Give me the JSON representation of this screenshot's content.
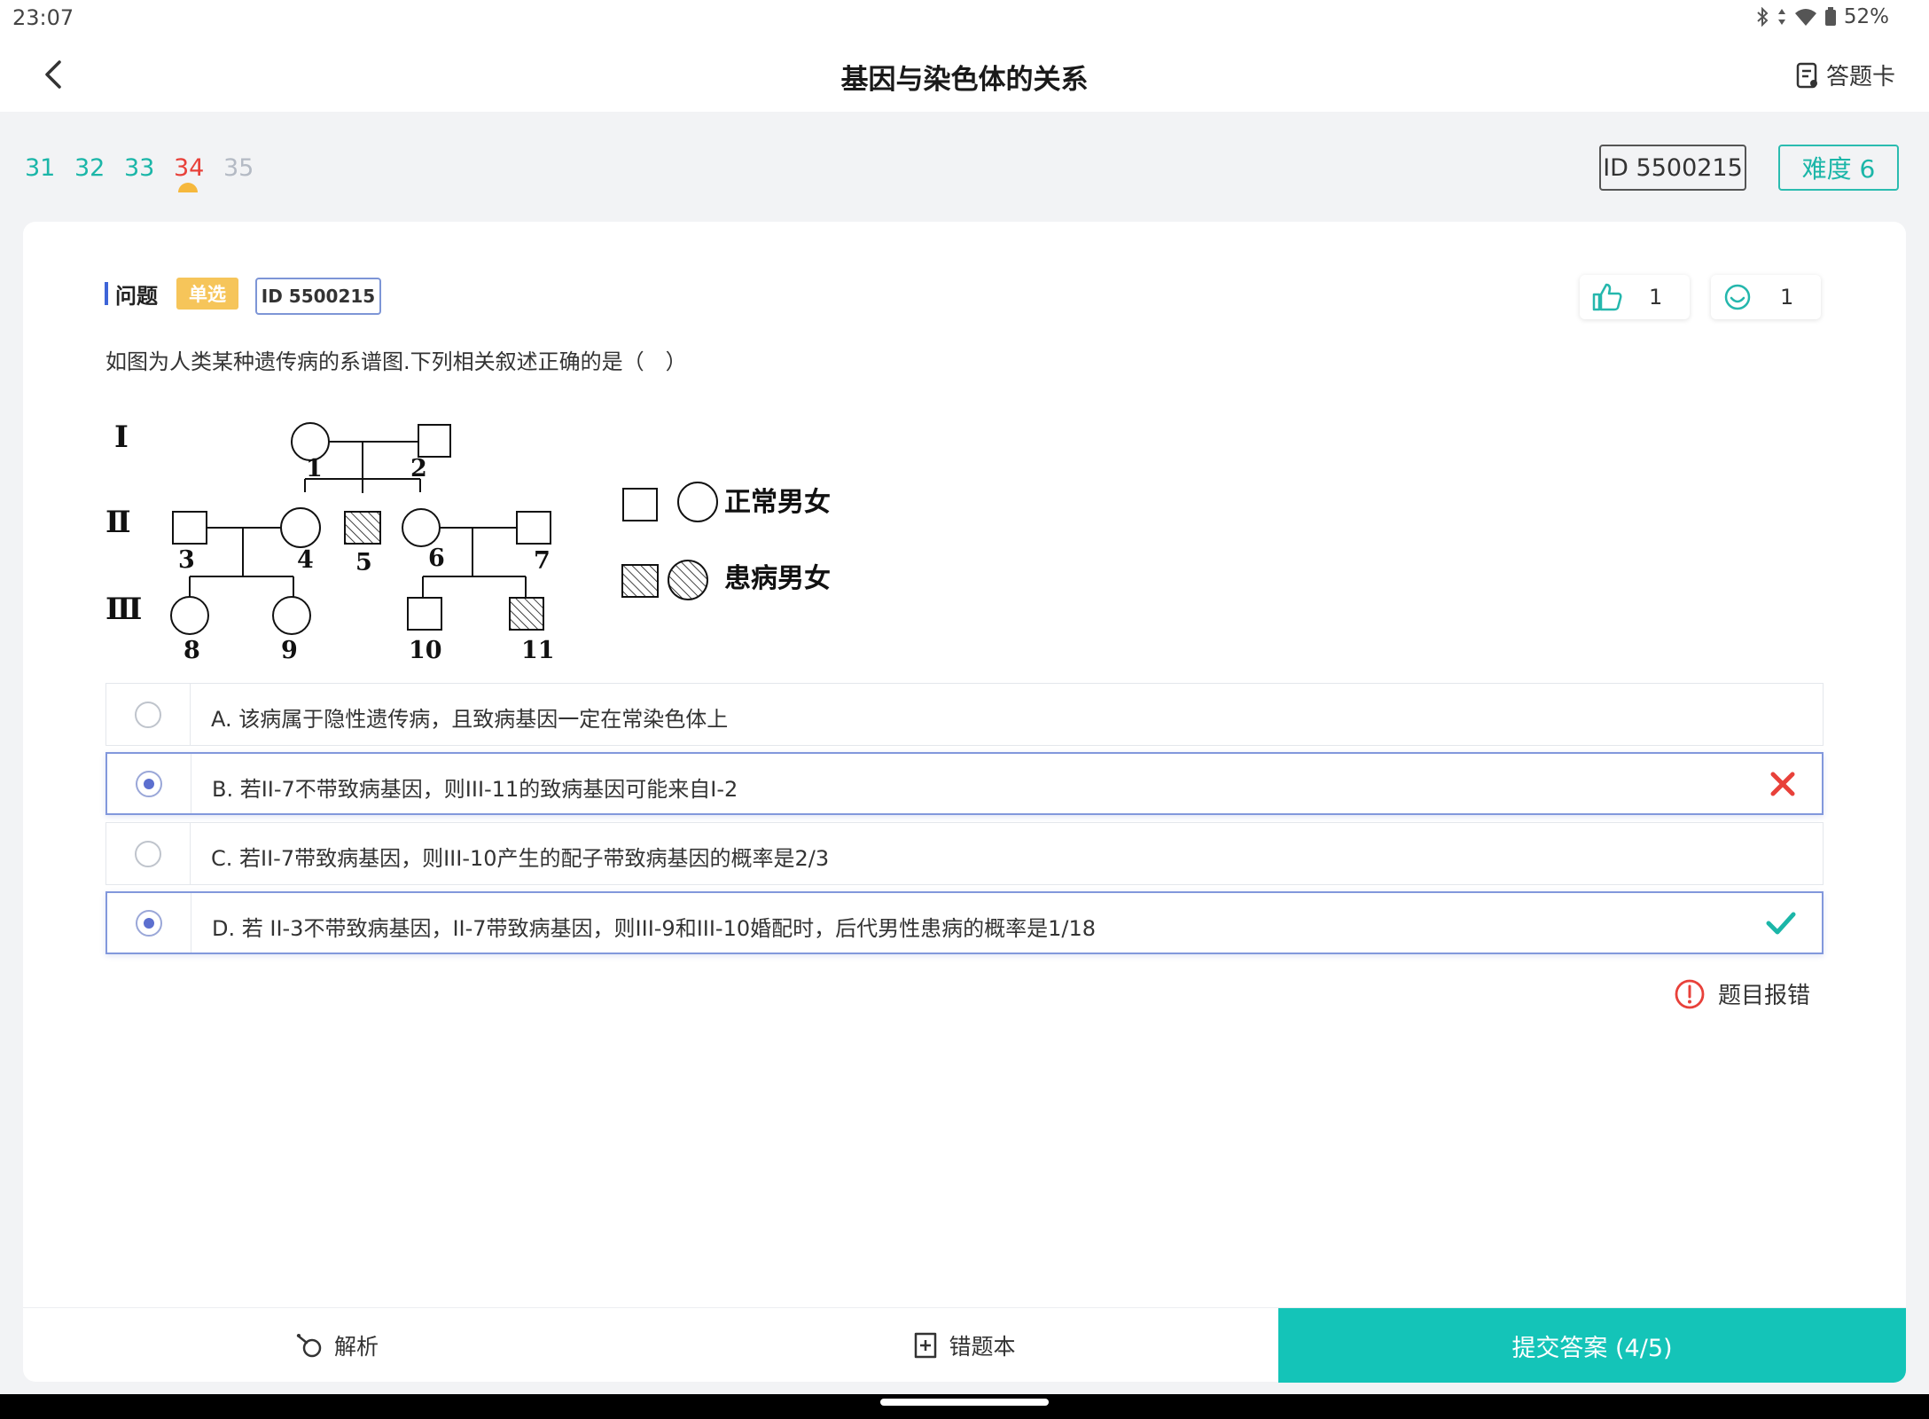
{
  "status_bar": {
    "time": "23:07",
    "battery": "52%"
  },
  "header": {
    "title": "基因与染色体的关系",
    "answer_card_label": "答题卡"
  },
  "question_nav": {
    "numbers": [
      "31",
      "32",
      "33",
      "34",
      "35"
    ],
    "id_label": "ID 5500215",
    "difficulty_label": "难度 6"
  },
  "question": {
    "label": "问题",
    "type": "单选",
    "id_label": "ID 5500215",
    "likes": "1",
    "smiles": "1",
    "stem": "如图为人类某种遗传病的系谱图.下列相关叙述正确的是（　）"
  },
  "pedigree": {
    "generations": [
      "Ⅰ",
      "Ⅱ",
      "Ⅲ"
    ],
    "individuals": [
      "1",
      "2",
      "3",
      "4",
      "5",
      "6",
      "7",
      "8",
      "9",
      "10",
      "11"
    ],
    "legend_normal": "正常男女",
    "legend_affected": "患病男女"
  },
  "options": [
    {
      "text": "A. 该病属于隐性遗传病，且致病基因一定在常染色体上",
      "selected": false,
      "result": ""
    },
    {
      "text": "B. 若II-7不带致病基因，则III-11的致病基因可能来自I-2",
      "selected": true,
      "result": "wrong"
    },
    {
      "text": "C. 若II-7带致病基因，则III-10产生的配子带致病基因的概率是2/3",
      "selected": false,
      "result": ""
    },
    {
      "text": "D. 若 II-3不带致病基因，II-7带致病基因，则III-9和III-10婚配时，后代男性患病的概率是1/18",
      "selected": true,
      "result": "correct"
    }
  ],
  "report_label": "题目报错",
  "bottom": {
    "analysis_label": "解析",
    "notebook_label": "错题本",
    "submit_label": "提交答案 (4/5)"
  },
  "colors": {
    "accent": "#14c4b8",
    "current": "#e8413a",
    "wrong": "#e8413a",
    "correct": "#1bb6a8",
    "selected_border": "#8298dc"
  },
  "icons": {
    "back": "chevron-left-icon",
    "answer_card": "answer-card-icon",
    "like": "thumbs-up-icon",
    "smile": "smile-icon",
    "wrong": "cross-icon",
    "correct": "check-icon",
    "report": "alert-circle-icon",
    "analysis": "analysis-icon",
    "notebook": "notebook-icon"
  }
}
